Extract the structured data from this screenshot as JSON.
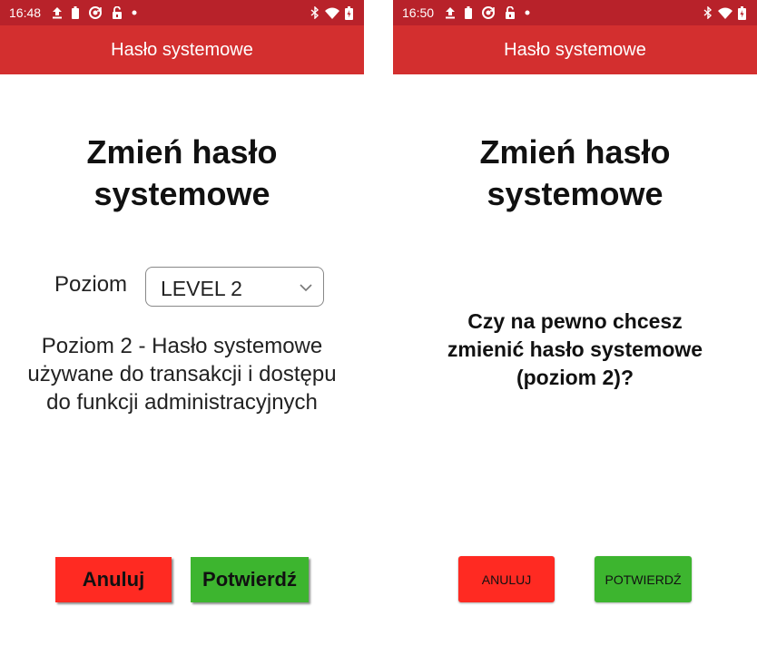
{
  "left_screen": {
    "status_time": "16:48",
    "app_title": "Hasło systemowe",
    "heading_line1": "Zmień hasło",
    "heading_line2": "systemowe",
    "level_label": "Poziom",
    "level_selected": "LEVEL 2",
    "description_line1": "Poziom 2 - Hasło systemowe",
    "description_line2": "używane do transakcji i dostępu",
    "description_line3": "do funkcji administracyjnych",
    "cancel_label": "Anuluj",
    "confirm_label": "Potwierdź"
  },
  "right_screen": {
    "status_time": "16:50",
    "app_title": "Hasło systemowe",
    "heading_line1": "Zmień hasło",
    "heading_line2": "systemowe",
    "question_line1": "Czy na pewno chcesz",
    "question_line2": "zmienić hasło systemowe",
    "question_line3": "(poziom 2)?",
    "cancel_label": "ANULUJ",
    "confirm_label": "POTWIERDŹ"
  },
  "status_icons_left": [
    "upload-icon",
    "battery-saver-icon",
    "sync-icon",
    "unlock-icon",
    "dot-icon"
  ],
  "status_icons_right": [
    "bluetooth-icon",
    "wifi-icon",
    "battery-icon"
  ],
  "colors": {
    "status_bar": "#b8222a",
    "app_bar": "#d32f2f",
    "cancel_button": "#ff2a22",
    "confirm_button": "#3db52f"
  }
}
